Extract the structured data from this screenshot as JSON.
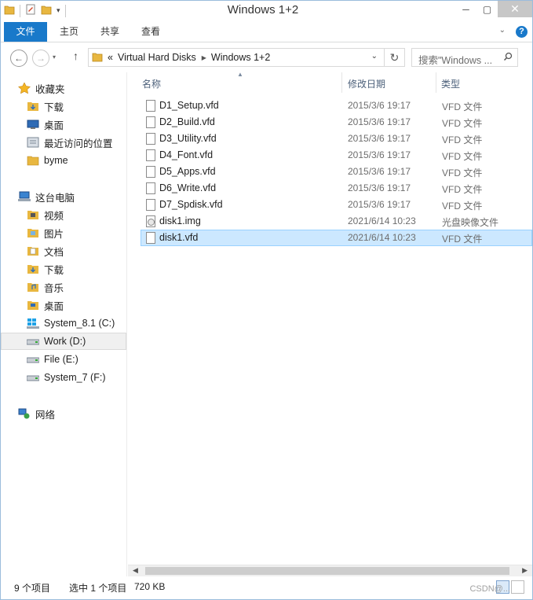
{
  "window": {
    "title": "Windows 1+2"
  },
  "ribbon": {
    "tabs": [
      "文件",
      "主页",
      "共享",
      "查看"
    ],
    "help": "?"
  },
  "address": {
    "overflow": "«",
    "crumbs": [
      "Virtual Hard Disks",
      "Windows 1+2"
    ],
    "search_placeholder": "搜索\"Windows ..."
  },
  "nav": {
    "favorites": {
      "label": "收藏夹",
      "items": [
        "下载",
        "桌面",
        "最近访问的位置",
        "byme"
      ]
    },
    "pc": {
      "label": "这台电脑",
      "items": [
        "视频",
        "图片",
        "文档",
        "下载",
        "音乐",
        "桌面",
        "System_8.1 (C:)",
        "Work (D:)",
        "File (E:)",
        "System_7 (F:)"
      ]
    },
    "network": {
      "label": "网络"
    }
  },
  "list": {
    "columns": {
      "name": "名称",
      "date": "修改日期",
      "type": "类型"
    },
    "files": [
      {
        "name": "D1_Setup.vfd",
        "date": "2015/3/6 19:17",
        "type": "VFD 文件"
      },
      {
        "name": "D2_Build.vfd",
        "date": "2015/3/6 19:17",
        "type": "VFD 文件"
      },
      {
        "name": "D3_Utility.vfd",
        "date": "2015/3/6 19:17",
        "type": "VFD 文件"
      },
      {
        "name": "D4_Font.vfd",
        "date": "2015/3/6 19:17",
        "type": "VFD 文件"
      },
      {
        "name": "D5_Apps.vfd",
        "date": "2015/3/6 19:17",
        "type": "VFD 文件"
      },
      {
        "name": "D6_Write.vfd",
        "date": "2015/3/6 19:17",
        "type": "VFD 文件"
      },
      {
        "name": "D7_Spdisk.vfd",
        "date": "2015/3/6 19:17",
        "type": "VFD 文件"
      },
      {
        "name": "disk1.img",
        "date": "2021/6/14 10:23",
        "type": "光盘映像文件"
      },
      {
        "name": "disk1.vfd",
        "date": "2021/6/14 10:23",
        "type": "VFD 文件"
      }
    ]
  },
  "status": {
    "count": "9 个项目",
    "selected": "选中 1 个项目",
    "size": "720 KB"
  },
  "watermark": "CSDN@...",
  "colors": {
    "accent": "#1979ca",
    "selection": "#cce8ff"
  }
}
